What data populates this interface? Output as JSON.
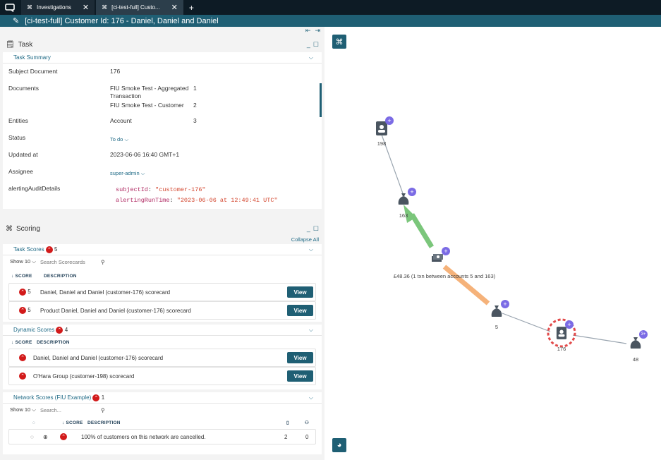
{
  "tabs": [
    {
      "label": "Investigations"
    },
    {
      "label": "[ci-test-full] Custo..."
    }
  ],
  "add_tab": "+",
  "title": "[ci-test-full] Customer Id: 176 - Daniel, Daniel and Daniel",
  "task_panel": {
    "title": "Task",
    "summary_title": "Task Summary",
    "fields": {
      "subject_label": "Subject Document",
      "subject_value": "176",
      "documents_label": "Documents",
      "doc1_name": "FIU Smoke Test - Aggregated Transaction",
      "doc1_count": "1",
      "doc2_name": "FIU Smoke Test - Customer",
      "doc2_count": "2",
      "entities_label": "Entities",
      "entity_name": "Account",
      "entity_count": "3",
      "status_label": "Status",
      "status_value": "To do",
      "updated_label": "Updated at",
      "updated_value": "2023-06-06 16:40 GMT+1",
      "assignee_label": "Assignee",
      "assignee_value": "super-admin",
      "audit_label": "alertingAuditDetails",
      "audit_k1": "subjectId",
      "audit_v1": "\"customer-176\"",
      "audit_k2": "alertingRunTime",
      "audit_v2": "\"2023-06-06 at 12:49:41 UTC\""
    }
  },
  "scoring": {
    "title": "Scoring",
    "collapse_all": "Collapse All",
    "task_scores": {
      "title": "Task Scores",
      "count": "5",
      "show": "Show 10",
      "search_placeholder": "Search Scorecards",
      "col_score": "↓ SCORE",
      "col_desc": "DESCRIPTION",
      "rows": [
        {
          "score": "5",
          "desc": "Daniel, Daniel and Daniel (customer-176) scorecard",
          "btn": "View"
        },
        {
          "score": "5",
          "desc": "Product Daniel, Daniel and Daniel (customer-176) scorecard",
          "btn": "View"
        }
      ]
    },
    "dynamic_scores": {
      "title": "Dynamic Scores",
      "count": "4",
      "col_score": "↓ SCORE",
      "col_desc": "DESCRIPTION",
      "rows": [
        {
          "desc": "Daniel, Daniel and Daniel (customer-176) scorecard",
          "btn": "View"
        },
        {
          "desc": "O'Hara Group (customer-198) scorecard",
          "btn": "View"
        }
      ]
    },
    "network_scores": {
      "title": "Network Scores (FIU Example)",
      "count": "1",
      "show": "Show 10",
      "search_placeholder": "Search...",
      "col_score": "↓ SCORE",
      "col_desc": "DESCRIPTION",
      "rows": [
        {
          "desc": "100% of customers on this network are cancelled.",
          "c1": "2",
          "c2": "0"
        }
      ]
    }
  },
  "graph": {
    "nodes": {
      "n198": "198",
      "n163": "163",
      "n5": "5",
      "n176": "176",
      "n48": "48"
    },
    "edge_label": "£48.36 (1 txn between accounts 5 and 163)",
    "plus": "+",
    "plus_multi": "3+"
  }
}
